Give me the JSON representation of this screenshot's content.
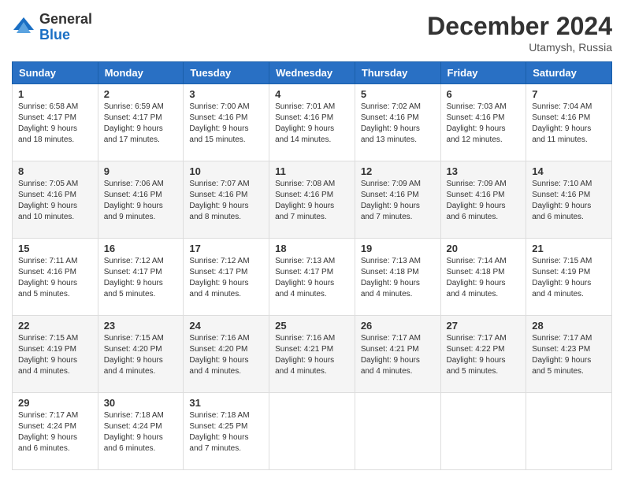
{
  "logo": {
    "general": "General",
    "blue": "Blue"
  },
  "header": {
    "month": "December 2024",
    "location": "Utamysh, Russia"
  },
  "weekdays": [
    "Sunday",
    "Monday",
    "Tuesday",
    "Wednesday",
    "Thursday",
    "Friday",
    "Saturday"
  ],
  "weeks": [
    [
      {
        "day": "1",
        "sunrise": "6:58 AM",
        "sunset": "4:17 PM",
        "daylight": "9 hours and 18 minutes."
      },
      {
        "day": "2",
        "sunrise": "6:59 AM",
        "sunset": "4:17 PM",
        "daylight": "9 hours and 17 minutes."
      },
      {
        "day": "3",
        "sunrise": "7:00 AM",
        "sunset": "4:16 PM",
        "daylight": "9 hours and 15 minutes."
      },
      {
        "day": "4",
        "sunrise": "7:01 AM",
        "sunset": "4:16 PM",
        "daylight": "9 hours and 14 minutes."
      },
      {
        "day": "5",
        "sunrise": "7:02 AM",
        "sunset": "4:16 PM",
        "daylight": "9 hours and 13 minutes."
      },
      {
        "day": "6",
        "sunrise": "7:03 AM",
        "sunset": "4:16 PM",
        "daylight": "9 hours and 12 minutes."
      },
      {
        "day": "7",
        "sunrise": "7:04 AM",
        "sunset": "4:16 PM",
        "daylight": "9 hours and 11 minutes."
      }
    ],
    [
      {
        "day": "8",
        "sunrise": "7:05 AM",
        "sunset": "4:16 PM",
        "daylight": "9 hours and 10 minutes."
      },
      {
        "day": "9",
        "sunrise": "7:06 AM",
        "sunset": "4:16 PM",
        "daylight": "9 hours and 9 minutes."
      },
      {
        "day": "10",
        "sunrise": "7:07 AM",
        "sunset": "4:16 PM",
        "daylight": "9 hours and 8 minutes."
      },
      {
        "day": "11",
        "sunrise": "7:08 AM",
        "sunset": "4:16 PM",
        "daylight": "9 hours and 7 minutes."
      },
      {
        "day": "12",
        "sunrise": "7:09 AM",
        "sunset": "4:16 PM",
        "daylight": "9 hours and 7 minutes."
      },
      {
        "day": "13",
        "sunrise": "7:09 AM",
        "sunset": "4:16 PM",
        "daylight": "9 hours and 6 minutes."
      },
      {
        "day": "14",
        "sunrise": "7:10 AM",
        "sunset": "4:16 PM",
        "daylight": "9 hours and 6 minutes."
      }
    ],
    [
      {
        "day": "15",
        "sunrise": "7:11 AM",
        "sunset": "4:16 PM",
        "daylight": "9 hours and 5 minutes."
      },
      {
        "day": "16",
        "sunrise": "7:12 AM",
        "sunset": "4:17 PM",
        "daylight": "9 hours and 5 minutes."
      },
      {
        "day": "17",
        "sunrise": "7:12 AM",
        "sunset": "4:17 PM",
        "daylight": "9 hours and 4 minutes."
      },
      {
        "day": "18",
        "sunrise": "7:13 AM",
        "sunset": "4:17 PM",
        "daylight": "9 hours and 4 minutes."
      },
      {
        "day": "19",
        "sunrise": "7:13 AM",
        "sunset": "4:18 PM",
        "daylight": "9 hours and 4 minutes."
      },
      {
        "day": "20",
        "sunrise": "7:14 AM",
        "sunset": "4:18 PM",
        "daylight": "9 hours and 4 minutes."
      },
      {
        "day": "21",
        "sunrise": "7:15 AM",
        "sunset": "4:19 PM",
        "daylight": "9 hours and 4 minutes."
      }
    ],
    [
      {
        "day": "22",
        "sunrise": "7:15 AM",
        "sunset": "4:19 PM",
        "daylight": "9 hours and 4 minutes."
      },
      {
        "day": "23",
        "sunrise": "7:15 AM",
        "sunset": "4:20 PM",
        "daylight": "9 hours and 4 minutes."
      },
      {
        "day": "24",
        "sunrise": "7:16 AM",
        "sunset": "4:20 PM",
        "daylight": "9 hours and 4 minutes."
      },
      {
        "day": "25",
        "sunrise": "7:16 AM",
        "sunset": "4:21 PM",
        "daylight": "9 hours and 4 minutes."
      },
      {
        "day": "26",
        "sunrise": "7:17 AM",
        "sunset": "4:21 PM",
        "daylight": "9 hours and 4 minutes."
      },
      {
        "day": "27",
        "sunrise": "7:17 AM",
        "sunset": "4:22 PM",
        "daylight": "9 hours and 5 minutes."
      },
      {
        "day": "28",
        "sunrise": "7:17 AM",
        "sunset": "4:23 PM",
        "daylight": "9 hours and 5 minutes."
      }
    ],
    [
      {
        "day": "29",
        "sunrise": "7:17 AM",
        "sunset": "4:24 PM",
        "daylight": "9 hours and 6 minutes."
      },
      {
        "day": "30",
        "sunrise": "7:18 AM",
        "sunset": "4:24 PM",
        "daylight": "9 hours and 6 minutes."
      },
      {
        "day": "31",
        "sunrise": "7:18 AM",
        "sunset": "4:25 PM",
        "daylight": "9 hours and 7 minutes."
      },
      null,
      null,
      null,
      null
    ]
  ],
  "labels": {
    "sunrise": "Sunrise:",
    "sunset": "Sunset:",
    "daylight": "Daylight:"
  }
}
